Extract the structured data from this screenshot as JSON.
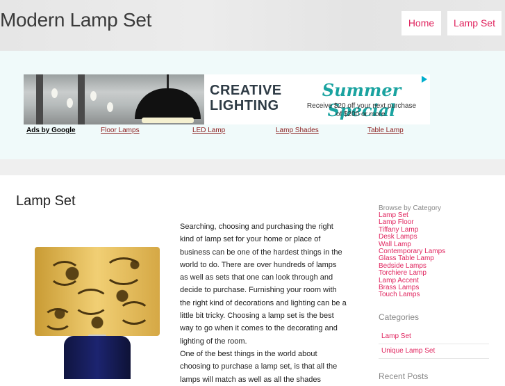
{
  "site": {
    "title": "Modern Lamp Set"
  },
  "nav": {
    "items": [
      {
        "label": "Home"
      },
      {
        "label": "Lamp Set"
      }
    ]
  },
  "ad": {
    "brand_line1": "CREATIVE",
    "brand_line2": "LIGHTING",
    "headline": "Summer Special",
    "sub_line1": "Receive $20 off your next purchase",
    "sub_line2": "of $200 or more.",
    "links": [
      {
        "label": "Ads by Google"
      },
      {
        "label": "Floor Lamps"
      },
      {
        "label": "LED Lamp"
      },
      {
        "label": "Lamp Shades"
      },
      {
        "label": "Table Lamp"
      }
    ]
  },
  "main": {
    "title": "Lamp Set",
    "paragraph1": "Searching, choosing and purchasing the right kind of lamp set for your home or place of business can be one of the hardest things in the world to do. There are over hundreds of lamps as well as sets that one can look through and decide to purchase. Furnishing your room with the right kind of decorations and lighting can be a little bit tricky. Choosing a lamp set is the best way to go when it comes to the decorating and lighting of the room.",
    "paragraph2": "One of the best things in the world about choosing to purchase a lamp set, is that all the lamps will match as well as all the shades"
  },
  "sidebar": {
    "browse_heading": "Browse by Category",
    "browse_links": [
      "Lamp Set",
      "Lamp Floor",
      "Tiffany Lamp",
      "Desk Lamps",
      "Wall Lamp",
      "Contemporary Lamps",
      "Glass Table Lamp",
      "Bedside Lamps",
      "Torchiere Lamp",
      "Lamp Accent",
      "Brass Lamps",
      "Touch Lamps"
    ],
    "categories_heading": "Categories",
    "categories": [
      "Lamp Set",
      "Unique Lamp Set"
    ],
    "recent_heading": "Recent Posts"
  },
  "colors": {
    "link": "#e0245e",
    "ad_link": "#8b1e1e",
    "accent": "#1aa3a0"
  }
}
